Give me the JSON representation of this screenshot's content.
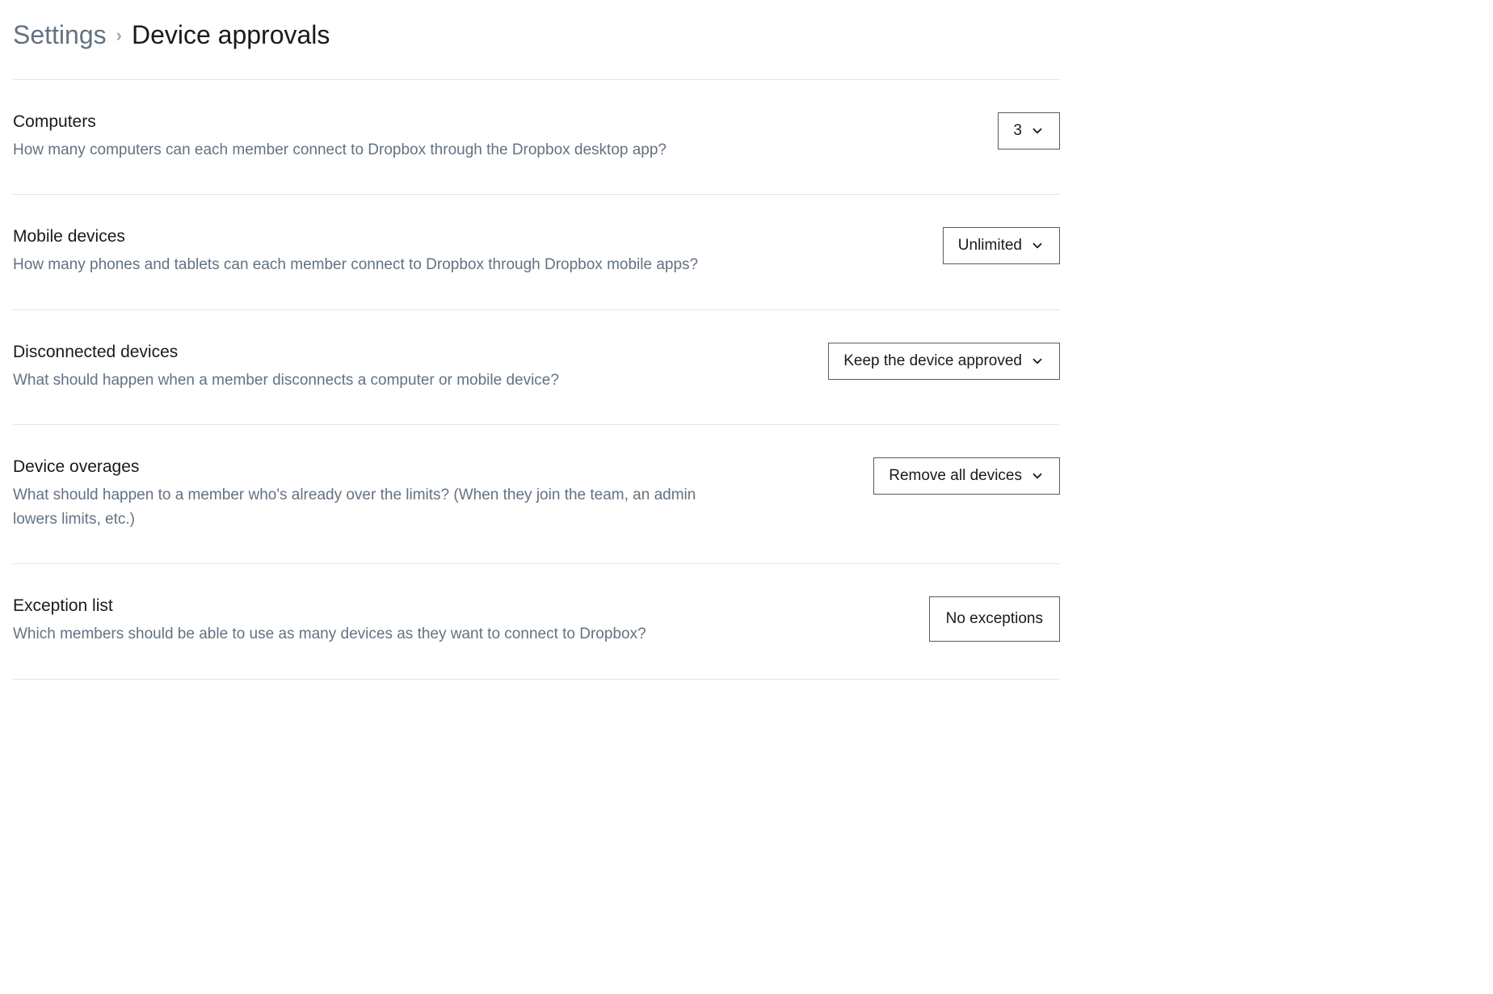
{
  "breadcrumb": {
    "parent": "Settings",
    "current": "Device approvals"
  },
  "rows": {
    "computers": {
      "title": "Computers",
      "desc": "How many computers can each member connect to Dropbox through the Dropbox desktop app?",
      "value": "3"
    },
    "mobile": {
      "title": "Mobile devices",
      "desc": "How many phones and tablets can each member connect to Dropbox through Dropbox mobile apps?",
      "value": "Unlimited"
    },
    "disconnected": {
      "title": "Disconnected devices",
      "desc": "What should happen when a member disconnects a computer or mobile device?",
      "value": "Keep the device approved"
    },
    "overages": {
      "title": "Device overages",
      "desc": "What should happen to a member who's already over the limits? (When they join the team, an admin lowers limits, etc.)",
      "value": "Remove all devices"
    },
    "exceptions": {
      "title": "Exception list",
      "desc": "Which members should be able to use as many devices as they want to connect to Dropbox?",
      "value": "No exceptions"
    }
  }
}
